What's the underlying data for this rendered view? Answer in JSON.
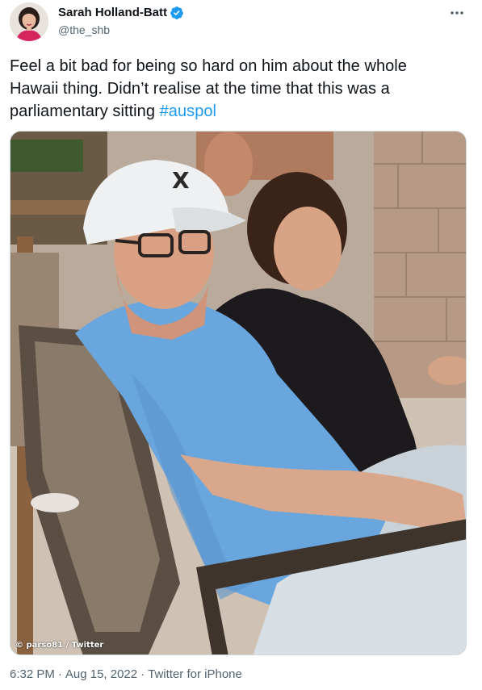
{
  "author": {
    "display_name": "Sarah Holland-Batt",
    "handle": "@the_shb",
    "verified": true,
    "avatar_icon": "profile-photo"
  },
  "menu": {
    "more_icon": "more-horizontal-icon"
  },
  "tweet": {
    "text_lines": [
      "Feel a bit bad for being so hard on him about the whole",
      "Hawaii thing. Didn’t realise at the time that this was a",
      "parliamentary sitting "
    ],
    "hashtag": "#auspol"
  },
  "media": {
    "watermark": "© parso81 / Twitter"
  },
  "meta": {
    "time": "6:32 PM",
    "date": "Aug 15, 2022",
    "source": "Twitter for iPhone",
    "separator": "·"
  },
  "colors": {
    "link": "#1d9bf0",
    "secondary_text": "#536471",
    "primary_text": "#0f1419",
    "verified": "#1d9bf0"
  }
}
